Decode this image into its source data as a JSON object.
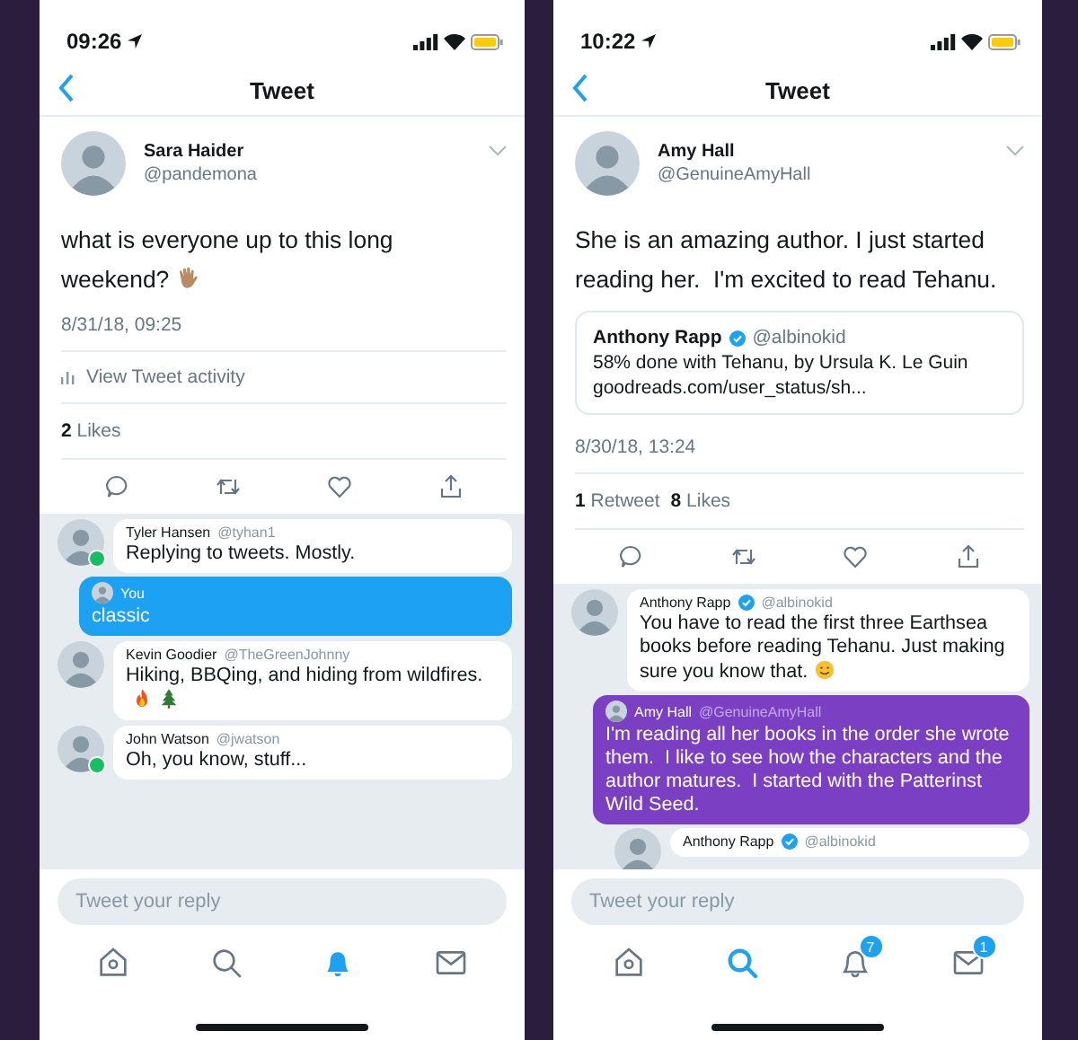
{
  "phones": [
    {
      "status_bar": {
        "time": "09:26"
      },
      "nav": {
        "title": "Tweet"
      },
      "tweet": {
        "author": {
          "name": "Sara Haider",
          "handle": "@pandemona"
        },
        "text": "what is everyone up to this long weekend?",
        "icons": [
          {
            "kind": "wave"
          }
        ],
        "timestamp": "8/31/18, 09:25",
        "activity": "View Tweet activity",
        "stats": [
          "**2** Likes"
        ]
      },
      "replies": [
        {
          "kind": "reply",
          "name": "Tyler Hansen",
          "handle": "@tyhan1",
          "online": true,
          "text": "Replying to tweets. Mostly.",
          "children": [
            {
              "kind": "own",
              "name": "You",
              "color": "#1da1f2",
              "text": "classic"
            }
          ]
        },
        {
          "kind": "reply",
          "name": "Kevin Goodier",
          "handle": "@TheGreenJohnny",
          "text": "Hiking, BBQing, and hiding from wildfires.",
          "icons": [
            {
              "kind": "fire"
            },
            {
              "kind": "tree"
            }
          ]
        },
        {
          "kind": "reply",
          "name": "John Watson",
          "handle": "@jwatson",
          "online": true,
          "text": "Oh, you know, stuff..."
        }
      ],
      "reply_field": {
        "placeholder": "Tweet your reply"
      },
      "tabs": [
        {
          "kind": "home",
          "selected": false
        },
        {
          "kind": "search",
          "selected": false
        },
        {
          "kind": "notifications",
          "selected": true
        },
        {
          "kind": "messages",
          "selected": false
        }
      ]
    },
    {
      "status_bar": {
        "time": "10:22"
      },
      "nav": {
        "title": "Tweet"
      },
      "tweet": {
        "author": {
          "name": "Amy Hall",
          "handle": "@GenuineAmyHall"
        },
        "text": "She is an amazing author. I just started reading her.  I'm excited to read Tehanu.",
        "quote": {
          "name": "Anthony Rapp",
          "verified": true,
          "handle": "@albinokid",
          "text": "58% done with Tehanu, by Ursula K. Le Guin",
          "link": "goodreads.com/user_status/sh..."
        },
        "timestamp": "8/30/18, 13:24",
        "stats": [
          "**1** Retweet",
          "**8** Likes"
        ]
      },
      "replies": [
        {
          "kind": "reply",
          "name": "Anthony Rapp",
          "handle": "@albinokid",
          "verified": true,
          "text": "You have to read the first three Earthsea books before reading Tehanu. Just making sure you know that.",
          "icons": [
            {
              "kind": "smile"
            }
          ],
          "children": [
            {
              "kind": "own",
              "name": "Amy Hall",
              "handle": "@GenuineAmyHall",
              "color": "#7b3fc4",
              "text": "I'm reading all her books in the order she wrote them.  I like to see how the characters and the author matures.  I started with the Patterinst Wild Seed.",
              "children": [
                {
                  "kind": "reply",
                  "name": "Anthony Rapp",
                  "handle": "@albinokid",
                  "verified": true
                }
              ]
            }
          ]
        }
      ],
      "reply_field": {
        "placeholder": "Tweet your reply"
      },
      "tabs": [
        {
          "kind": "home",
          "selected": false
        },
        {
          "kind": "search",
          "selected": true
        },
        {
          "kind": "notifications",
          "selected": false,
          "badge": "7"
        },
        {
          "kind": "messages",
          "selected": false,
          "badge": "1"
        }
      ]
    }
  ]
}
